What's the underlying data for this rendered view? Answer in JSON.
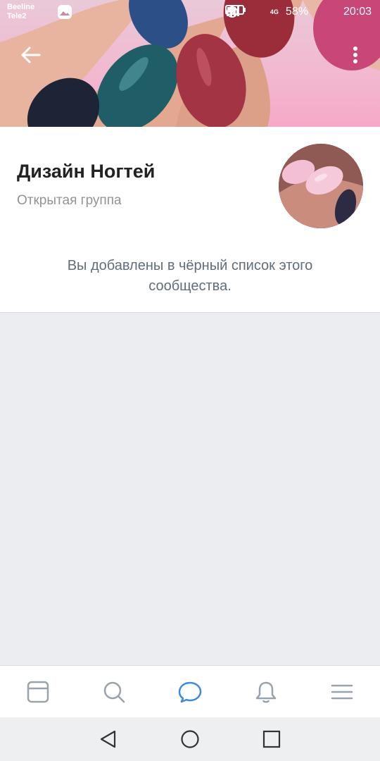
{
  "status_bar": {
    "carrier_1": "Beeline",
    "carrier_2": "Tele2",
    "network": "4G",
    "battery": "58%",
    "time": "20:03"
  },
  "group": {
    "name": "Дизайн Ногтей",
    "type": "Открытая группа",
    "blacklist_message": "Вы добавлены в чёрный список этого сообщества."
  },
  "tabs": [
    {
      "icon": "news-icon",
      "active": false
    },
    {
      "icon": "search-icon",
      "active": false
    },
    {
      "icon": "messages-icon",
      "active": true
    },
    {
      "icon": "notifications-icon",
      "active": false
    },
    {
      "icon": "menu-icon",
      "active": false
    }
  ],
  "colors": {
    "accent": "#3f8ae0",
    "inactive_icon": "#99a2ad",
    "text_secondary": "#939393"
  }
}
